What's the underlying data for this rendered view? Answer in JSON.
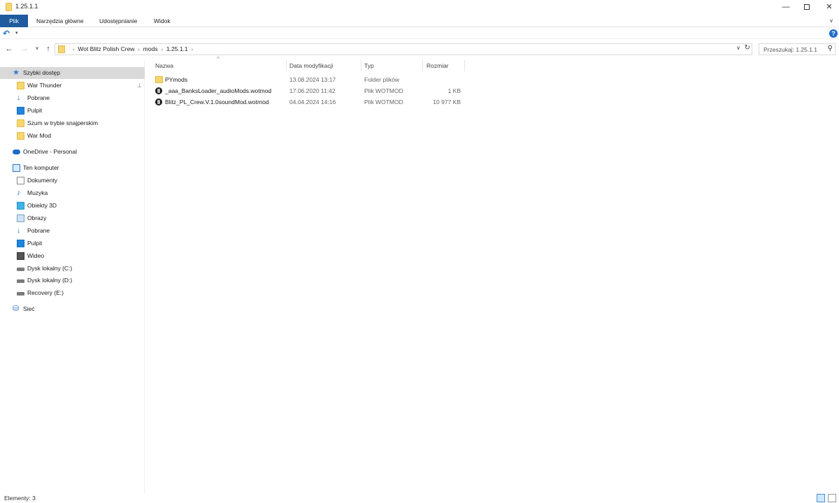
{
  "window": {
    "title": "1.25.1.1",
    "minimize": "—",
    "maximize": "",
    "close": "✕"
  },
  "ribbon": {
    "tabs": [
      "Plik",
      "Narzędzia główne",
      "Udostępnianie",
      "Widok"
    ]
  },
  "nav": {
    "back": "←",
    "forward": "→",
    "recent": "∨",
    "up": "↑"
  },
  "address": {
    "crumbs": [
      "Wot Blitz Polish Crew",
      "mods",
      "1.25.1.1"
    ],
    "separator": "›"
  },
  "search": {
    "placeholder": "Przeszukaj: 1.25.1.1"
  },
  "sidebar": {
    "items": [
      {
        "label": "Szybki dostęp",
        "icon": "star-icon"
      },
      {
        "label": "War Thunder",
        "icon": "folder-icon"
      },
      {
        "label": "Pobrane",
        "icon": "download-icon"
      },
      {
        "label": "Pulpit",
        "icon": "desktop-icon"
      },
      {
        "label": "Szum w trybie snajperskim",
        "icon": "folder-icon"
      },
      {
        "label": "War Mod",
        "icon": "folder-icon"
      },
      {
        "label": "OneDrive - Personal",
        "icon": "cloud-icon"
      },
      {
        "label": "Ten komputer",
        "icon": "computer-icon"
      },
      {
        "label": "Dokumenty",
        "icon": "document-icon"
      },
      {
        "label": "Muzyka",
        "icon": "music-icon"
      },
      {
        "label": "Obiekty 3D",
        "icon": "cube-icon"
      },
      {
        "label": "Obrazy",
        "icon": "image-icon"
      },
      {
        "label": "Pobrane",
        "icon": "download-icon"
      },
      {
        "label": "Pulpit",
        "icon": "desktop-icon"
      },
      {
        "label": "Wideo",
        "icon": "video-icon"
      },
      {
        "label": "Dysk lokalny (C:)",
        "icon": "drive-icon"
      },
      {
        "label": "Dysk lokalny (D:)",
        "icon": "drive-icon"
      },
      {
        "label": "Recovery (E:)",
        "icon": "drive-icon"
      },
      {
        "label": "Sieć",
        "icon": "network-icon"
      }
    ]
  },
  "columns": {
    "name": "Nazwa",
    "date": "Data modyfikacji",
    "type": "Typ",
    "size": "Rozmiar"
  },
  "files": [
    {
      "name": "PYmods",
      "date": "13.08.2024 13:17",
      "type": "Folder plików",
      "size": "",
      "icon": "folder-icon"
    },
    {
      "name": "_aaa_BanksLoader_audioMods.wotmod",
      "date": "17.06.2020 11:42",
      "type": "Plik WOTMOD",
      "size": "1 KB",
      "icon": "wotmod-file-icon"
    },
    {
      "name": "Blitz_PL_Crew.V.1.0soundMod.wotmod",
      "date": "04.04.2024 14:16",
      "type": "Plik WOTMOD",
      "size": "10 977 KB",
      "icon": "wotmod-file-icon"
    }
  ],
  "status": {
    "count": "Elementy: 3"
  },
  "colors": {
    "file_tab": "#1f5b9e",
    "selected": "#d9d9d9",
    "folder": "#f6d66f"
  }
}
